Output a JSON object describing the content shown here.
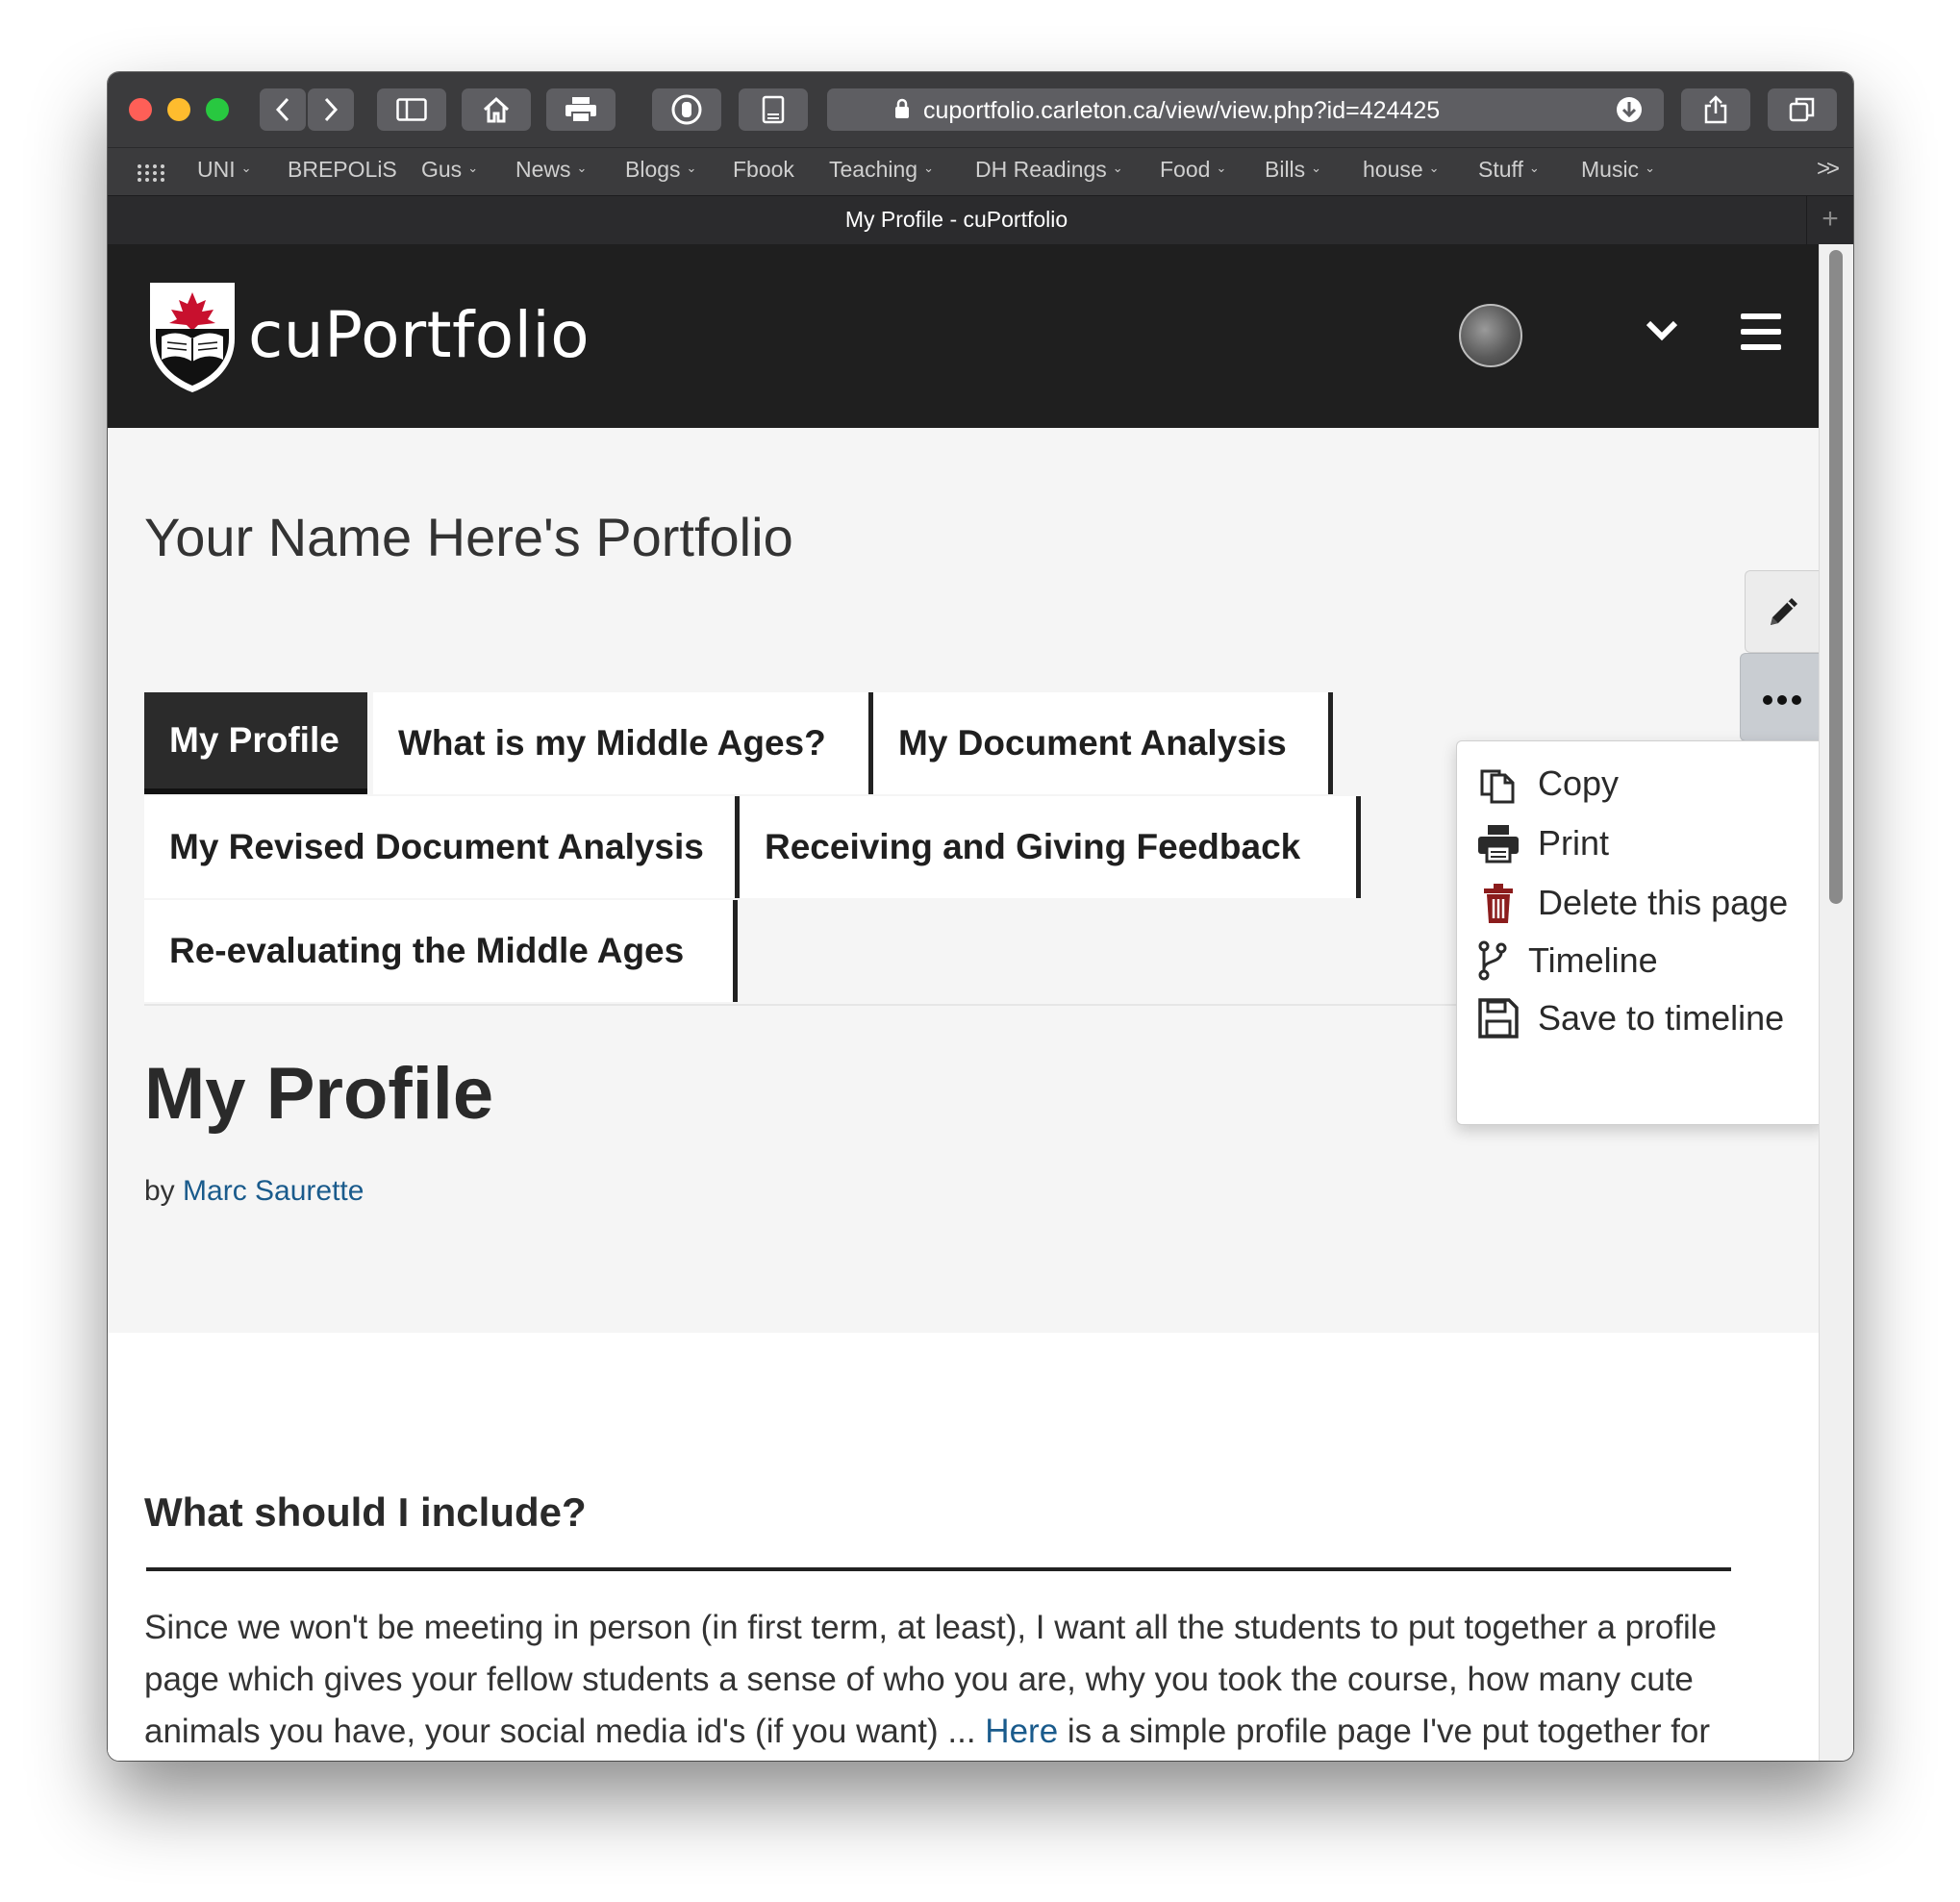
{
  "browser": {
    "url": "cuportfolio.carleton.ca/view/view.php?id=424425",
    "tab_title": "My Profile - cuPortfolio",
    "new_tab": "+",
    "overflow": ">>",
    "bookmarks": [
      {
        "label": "UNI",
        "dropdown": true
      },
      {
        "label": "BREPOLiS",
        "dropdown": false
      },
      {
        "label": "Gus",
        "dropdown": true
      },
      {
        "label": "News",
        "dropdown": true
      },
      {
        "label": "Blogs",
        "dropdown": true
      },
      {
        "label": "Fbook",
        "dropdown": false
      },
      {
        "label": "Teaching",
        "dropdown": true
      },
      {
        "label": "DH Readings",
        "dropdown": true
      },
      {
        "label": "Food",
        "dropdown": true
      },
      {
        "label": "Bills",
        "dropdown": true
      },
      {
        "label": "house",
        "dropdown": true
      },
      {
        "label": "Stuff",
        "dropdown": true
      },
      {
        "label": "Music",
        "dropdown": true
      }
    ]
  },
  "site": {
    "logo_text": "cuPortfolio",
    "portfolio_title": "Your Name Here's Portfolio",
    "nav_tabs": [
      {
        "label": "My Profile",
        "active": true
      },
      {
        "label": "What is my Middle Ages?",
        "active": false
      },
      {
        "label": "My Document Analysis",
        "active": false
      },
      {
        "label": "My Revised Document Analysis",
        "active": false
      },
      {
        "label": "Receiving and Giving Feedback",
        "active": false
      },
      {
        "label": "Re-evaluating the Middle Ages",
        "active": false
      }
    ],
    "page_heading": "My Profile",
    "byline_prefix": "by",
    "author": "Marc Saurette"
  },
  "content": {
    "section_heading": "What should I include?",
    "paragraph_before_link": "Since we won't be meeting in person (in first term, at least), I want all the students to put together a profile page which gives your fellow students a sense of who you are, why you took the course, how many cute animals you have, your social media id's (if you want) ... ",
    "link_text": "Here",
    "paragraph_after_link": " is a simple profile page I've put together for myself."
  },
  "menu": {
    "items": [
      {
        "label": "Copy",
        "icon": "copy-icon"
      },
      {
        "label": "Print",
        "icon": "print-icon"
      },
      {
        "label": "Delete this page",
        "icon": "trash-icon"
      },
      {
        "label": "Timeline",
        "icon": "branch-icon"
      },
      {
        "label": "Save to timeline",
        "icon": "save-icon"
      }
    ]
  },
  "colors": {
    "header_bg": "#1f1f1f",
    "link": "#1a5b8c",
    "delete_icon": "#8b1c1c",
    "logo_red": "#c8102e"
  }
}
